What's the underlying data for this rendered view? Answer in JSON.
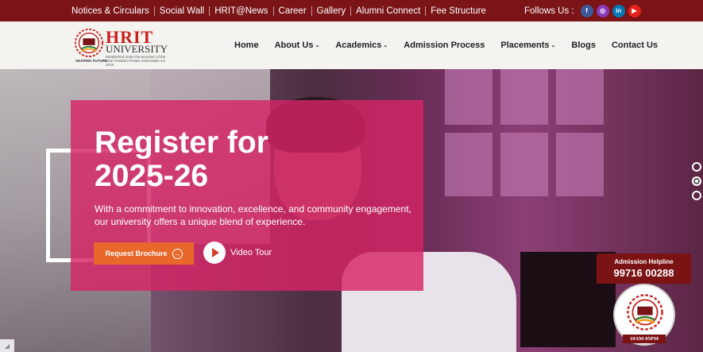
{
  "topbar": {
    "links": [
      "Notices & Circulars",
      "Social Wall",
      "HRIT@News",
      "Career",
      "Gallery",
      "Alumni Connect",
      "Fee Structure"
    ],
    "follow_label": "Follows Us :",
    "socials": [
      {
        "icon": "facebook-icon",
        "glyph": "f",
        "color": "#3b5998"
      },
      {
        "icon": "instagram-icon",
        "glyph": "◎",
        "color": "#8a3ab9"
      },
      {
        "icon": "linkedin-icon",
        "glyph": "in",
        "color": "#0077b5"
      },
      {
        "icon": "youtube-icon",
        "glyph": "▶",
        "color": "#e62117"
      }
    ]
  },
  "logo": {
    "name": "HRIT",
    "sub": "UNIVERSITY",
    "established": "Established under the provision of the Uttar Pradesh Private Universities Act 2019",
    "tagline": "SHAPING FUTURE"
  },
  "nav": {
    "home": "Home",
    "about": "About Us",
    "academics": "Academics",
    "admission": "Admission Process",
    "placements": "Placements",
    "blogs": "Blogs",
    "contact": "Contact Us"
  },
  "hero": {
    "headline_line1": "Register for",
    "headline_line2": "2025-26",
    "description_line1": "With a commitment to innovation, excellence, and community engagement,",
    "description_line2": "our university offers a unique blend of experience.",
    "brochure_label": "Request Brochure",
    "video_label": "Video Tour"
  },
  "helpline": {
    "title": "Admission Helpline",
    "number": "99716 00288",
    "hours": "10AM-05PM"
  },
  "colors": {
    "topbar": "#7a1417",
    "overlay": "#d62565",
    "brochure": "#e8672a",
    "brand_red": "#c8201f"
  }
}
